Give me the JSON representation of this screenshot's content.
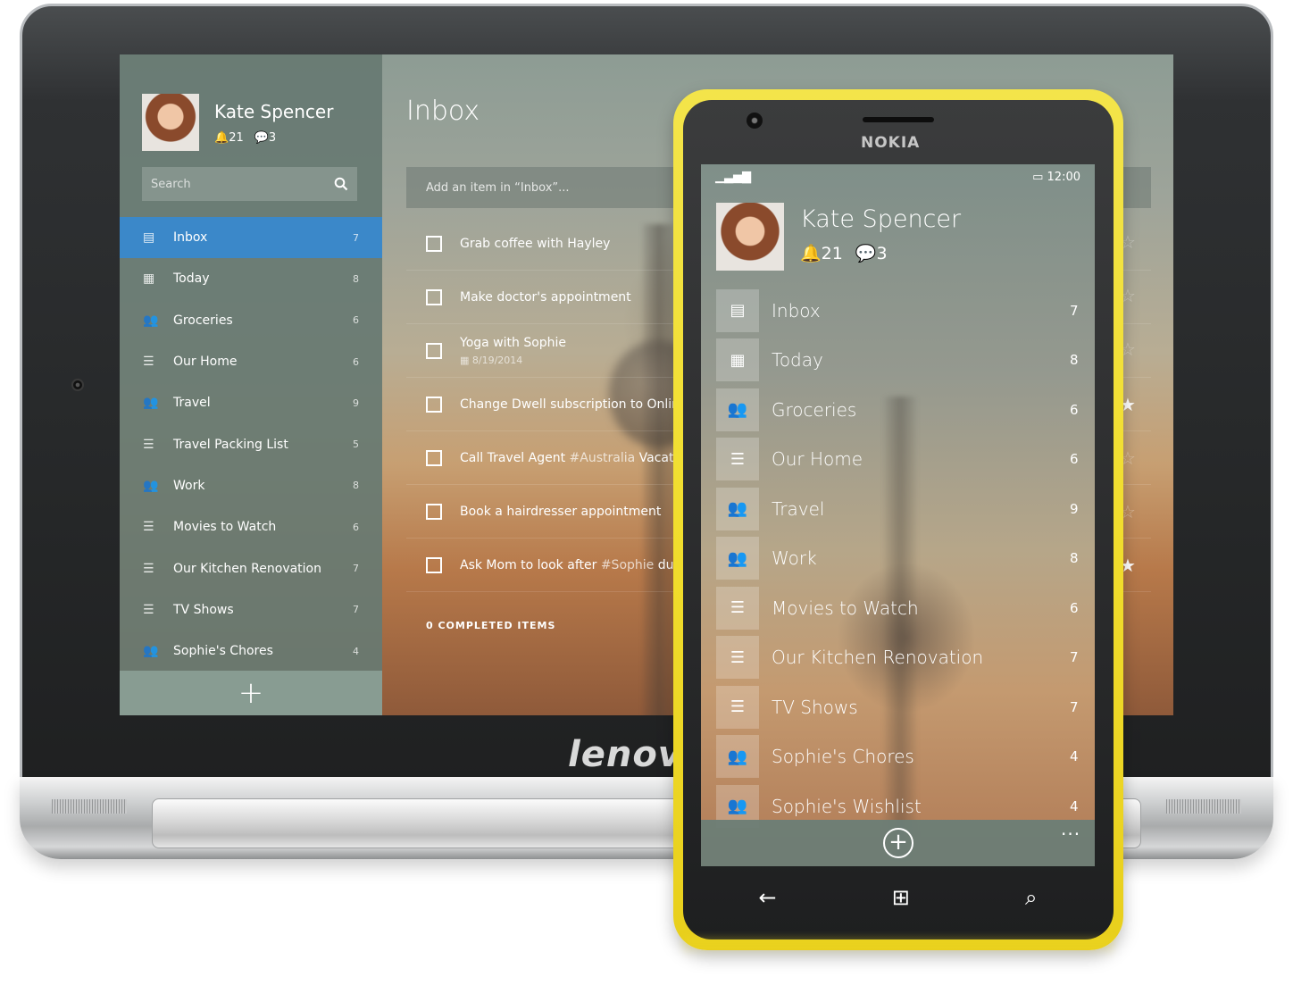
{
  "user": {
    "name": "Kate Spencer",
    "notifications": "21",
    "messages": "3"
  },
  "tablet": {
    "brand": "lenovo",
    "search_placeholder": "Search",
    "lists": [
      {
        "label": "Inbox",
        "count": "7",
        "icon": "inbox-icon",
        "active": true
      },
      {
        "label": "Today",
        "count": "8",
        "icon": "calendar-icon"
      },
      {
        "label": "Groceries",
        "count": "6",
        "icon": "shared-list-icon"
      },
      {
        "label": "Our Home",
        "count": "6",
        "icon": "list-icon"
      },
      {
        "label": "Travel",
        "count": "9",
        "icon": "shared-list-icon"
      },
      {
        "label": "Travel Packing List",
        "count": "5",
        "icon": "list-icon"
      },
      {
        "label": "Work",
        "count": "8",
        "icon": "shared-list-icon"
      },
      {
        "label": "Movies to Watch",
        "count": "6",
        "icon": "list-icon"
      },
      {
        "label": "Our Kitchen Renovation",
        "count": "7",
        "icon": "list-icon"
      },
      {
        "label": "TV Shows",
        "count": "7",
        "icon": "list-icon"
      },
      {
        "label": "Sophie's Chores",
        "count": "4",
        "icon": "shared-list-icon"
      }
    ],
    "main": {
      "title": "Inbox",
      "add_placeholder": "Add an item in “Inbox”...",
      "tasks": [
        {
          "text": "Grab coffee with Hayley"
        },
        {
          "text": "Make doctor's appointment"
        },
        {
          "text": "Yoga with Sophie",
          "date": "8/19/2014"
        },
        {
          "text": "Change Dwell subscription to Online a"
        },
        {
          "text": "Call Travel Agent ",
          "hashtag": "#Australia",
          "after": " Vacation"
        },
        {
          "text": "Book a hairdresser appointment"
        },
        {
          "text": "Ask Mom to look after ",
          "hashtag": "#Sophie",
          "after": " durin"
        }
      ],
      "completed_label": "0 COMPLETED ITEMS"
    }
  },
  "phone": {
    "brand": "NOKIA",
    "time": "12:00",
    "lists": [
      {
        "label": "Inbox",
        "count": "7",
        "icon": "inbox-icon"
      },
      {
        "label": "Today",
        "count": "8",
        "icon": "calendar-icon"
      },
      {
        "label": "Groceries",
        "count": "6",
        "icon": "shared-list-icon"
      },
      {
        "label": "Our Home",
        "count": "6",
        "icon": "list-icon"
      },
      {
        "label": "Travel",
        "count": "9",
        "icon": "shared-list-icon"
      },
      {
        "label": "Work",
        "count": "8",
        "icon": "shared-list-icon"
      },
      {
        "label": "Movies to Watch",
        "count": "6",
        "icon": "list-icon"
      },
      {
        "label": "Our Kitchen Renovation",
        "count": "7",
        "icon": "list-icon"
      },
      {
        "label": "TV Shows",
        "count": "7",
        "icon": "list-icon"
      },
      {
        "label": "Sophie's Chores",
        "count": "4",
        "icon": "shared-list-icon"
      },
      {
        "label": "Sophie's Wishlist",
        "count": "4",
        "icon": "shared-list-icon"
      }
    ],
    "more_label": "...",
    "colors": {
      "shell": "#f1de2e",
      "accent": "#3b88c9"
    }
  }
}
